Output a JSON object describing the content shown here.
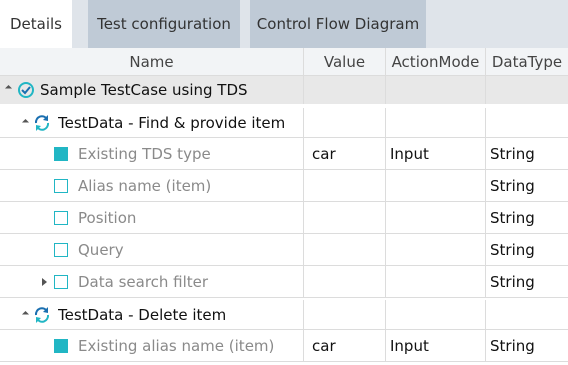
{
  "tabs": [
    {
      "label": "Details",
      "active": true
    },
    {
      "label": "Test configuration",
      "active": false
    },
    {
      "label": "Control Flow Diagram",
      "active": false
    }
  ],
  "columns": {
    "name": "Name",
    "value": "Value",
    "action": "ActionMode",
    "datatype": "DataType"
  },
  "testcase": {
    "label": "Sample TestCase using TDS",
    "icon": "testcase-icon"
  },
  "groups": [
    {
      "label": "TestData - Find & provide item",
      "icon": "refresh-icon",
      "attributes": [
        {
          "name": "Existing TDS type",
          "value": "car",
          "action": "Input",
          "datatype": "String",
          "filled": true,
          "expandable": false
        },
        {
          "name": "Alias name (item)",
          "value": "",
          "action": "",
          "datatype": "String",
          "filled": false,
          "expandable": false
        },
        {
          "name": "Position",
          "value": "",
          "action": "",
          "datatype": "String",
          "filled": false,
          "expandable": false
        },
        {
          "name": "Query",
          "value": "",
          "action": "",
          "datatype": "String",
          "filled": false,
          "expandable": false
        },
        {
          "name": "Data search filter",
          "value": "",
          "action": "",
          "datatype": "String",
          "filled": false,
          "expandable": true
        }
      ]
    },
    {
      "label": "TestData - Delete item",
      "icon": "refresh-icon",
      "attributes": [
        {
          "name": "Existing alias name (item)",
          "value": "car",
          "action": "Input",
          "datatype": "String",
          "filled": true,
          "expandable": false
        }
      ]
    }
  ],
  "colors": {
    "accent": "#21b6c4",
    "tab_bg": "#dfe4ea",
    "tab_inactive": "#bfcad6",
    "row_highlight": "#e8e8e8"
  }
}
